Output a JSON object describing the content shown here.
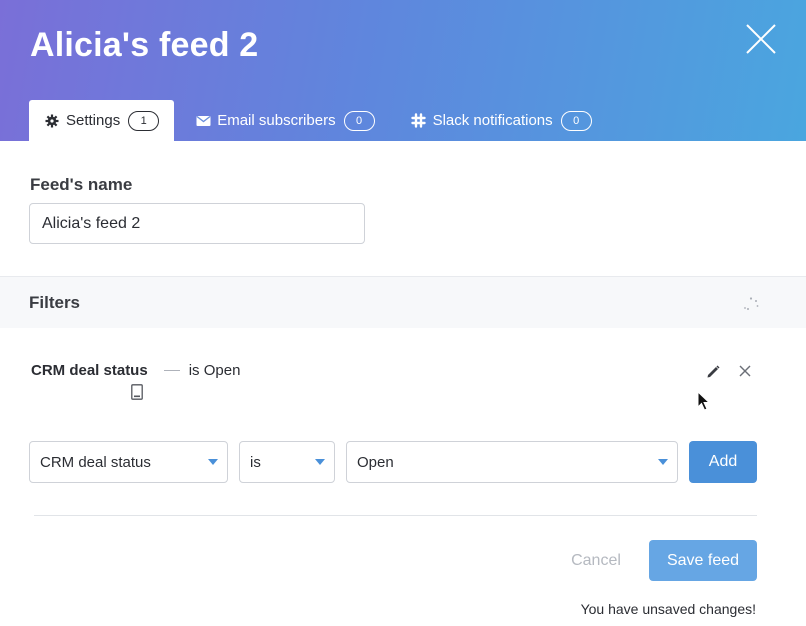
{
  "header": {
    "title": "Alicia's feed 2",
    "gradient_colors": [
      "#7a6fd8",
      "#5f86dd",
      "#4aa6df"
    ]
  },
  "tabs": [
    {
      "label": "Settings",
      "count": "1",
      "icon": "gear-icon",
      "active": true
    },
    {
      "label": "Email subscribers",
      "count": "0",
      "icon": "envelope-icon",
      "active": false
    },
    {
      "label": "Slack notifications",
      "count": "0",
      "icon": "slack-icon",
      "active": false
    }
  ],
  "name_section": {
    "label": "Feed's name",
    "value": "Alicia's feed 2"
  },
  "filters": {
    "title": "Filters",
    "rules": [
      {
        "field": "CRM deal status",
        "operator": "is",
        "value": "Open"
      }
    ],
    "editor": {
      "field": "CRM deal status",
      "operator": "is",
      "value": "Open",
      "add_label": "Add"
    }
  },
  "footer": {
    "cancel_label": "Cancel",
    "save_label": "Save feed",
    "status_text": "You have unsaved changes!"
  },
  "colors": {
    "accent": "#4a90d9",
    "save_button": "#66a6e4",
    "muted": "#b5b9c0"
  }
}
